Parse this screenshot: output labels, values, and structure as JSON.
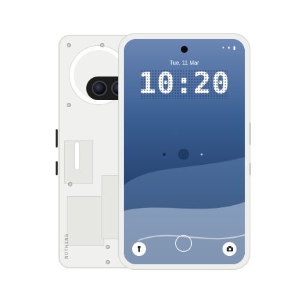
{
  "lock_screen": {
    "date": "Tue, 11 Mar",
    "time": "10:20",
    "status_icons": "• ▾ ▮"
  },
  "back": {
    "brand": "NOTHING"
  },
  "colors": {
    "screen_bg": "#1f3a63",
    "back_body": "#f0f0ee",
    "glyph_light": "#ffffff"
  },
  "icons": [
    "flashlight-icon",
    "fingerprint-icon",
    "camera-icon"
  ]
}
